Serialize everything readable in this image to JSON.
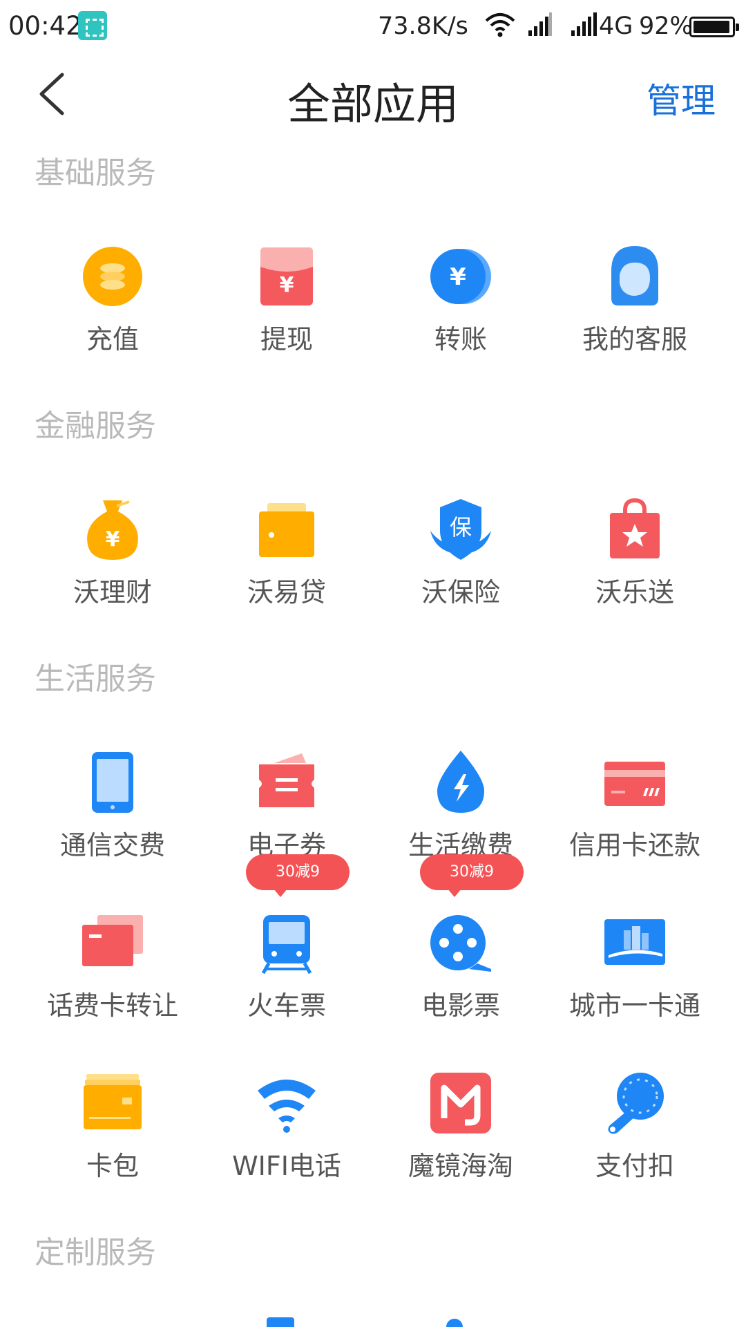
{
  "status_bar": {
    "time": "00:42",
    "speed": "73.8K/s",
    "network": "4G",
    "battery": "92%"
  },
  "header": {
    "title": "全部应用",
    "manage": "管理"
  },
  "sections": [
    {
      "title": "基础服务",
      "items": [
        {
          "label": "充值",
          "icon": "coin-stack-icon"
        },
        {
          "label": "提现",
          "icon": "red-envelope-icon"
        },
        {
          "label": "转账",
          "icon": "yuan-coin-icon"
        },
        {
          "label": "我的客服",
          "icon": "customer-service-icon"
        }
      ]
    },
    {
      "title": "金融服务",
      "items": [
        {
          "label": "沃理财",
          "icon": "money-bag-icon"
        },
        {
          "label": "沃易贷",
          "icon": "wallet-icon"
        },
        {
          "label": "沃保险",
          "icon": "insurance-shield-icon"
        },
        {
          "label": "沃乐送",
          "icon": "shopping-bag-icon"
        }
      ]
    },
    {
      "title": "生活服务",
      "items": [
        {
          "label": "通信交费",
          "icon": "phone-icon"
        },
        {
          "label": "电子券",
          "icon": "coupon-icon"
        },
        {
          "label": "生活缴费",
          "icon": "water-drop-icon"
        },
        {
          "label": "信用卡还款",
          "icon": "credit-card-icon"
        },
        {
          "label": "话费卡转让",
          "icon": "card-transfer-icon"
        },
        {
          "label": "火车票",
          "icon": "train-icon",
          "badge": "30减9"
        },
        {
          "label": "电影票",
          "icon": "film-reel-icon",
          "badge": "30减9"
        },
        {
          "label": "城市一卡通",
          "icon": "city-card-icon"
        },
        {
          "label": "卡包",
          "icon": "card-holder-icon"
        },
        {
          "label": "WIFI电话",
          "icon": "wifi-phone-icon"
        },
        {
          "label": "魔镜海淘",
          "icon": "mojing-logo-icon"
        },
        {
          "label": "支付扣",
          "icon": "pay-key-icon"
        }
      ]
    },
    {
      "title": "定制服务",
      "items": []
    }
  ]
}
